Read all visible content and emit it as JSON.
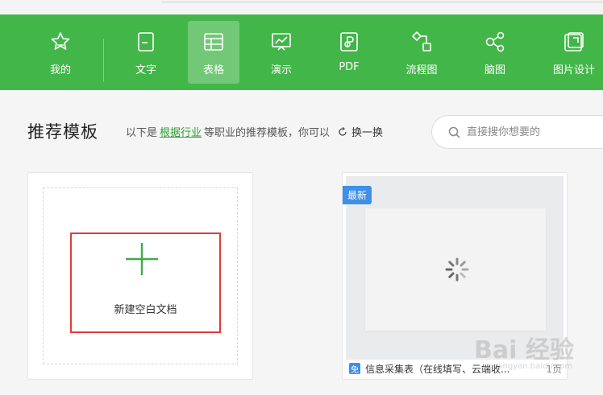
{
  "toolbar": {
    "items": [
      {
        "label": "我的",
        "icon": "star-icon"
      },
      {
        "label": "文字",
        "icon": "document-icon"
      },
      {
        "label": "表格",
        "icon": "table-icon",
        "active": true
      },
      {
        "label": "演示",
        "icon": "presentation-icon"
      },
      {
        "label": "PDF",
        "icon": "pdf-icon"
      },
      {
        "label": "流程图",
        "icon": "flowchart-icon"
      },
      {
        "label": "脑图",
        "icon": "mindmap-icon"
      },
      {
        "label": "图片设计",
        "icon": "image-design-icon"
      }
    ],
    "bg_color": "#43b649"
  },
  "section": {
    "title": "推荐模板",
    "subtitle_prefix": "以下是",
    "industry_link": "根据行业",
    "subtitle_suffix": "等职业的推荐模板，你可以",
    "refresh_label": "换一换"
  },
  "search": {
    "placeholder": "直接搜你想要的"
  },
  "new_doc": {
    "label": "新建空白文档"
  },
  "template_card": {
    "badge": "最新",
    "free_tag": "免",
    "title": "信息采集表（在线填写、云端收...",
    "pages": "1页"
  },
  "watermark": {
    "text": "Bai 经验",
    "sub": "jingyan.baidu.com"
  }
}
